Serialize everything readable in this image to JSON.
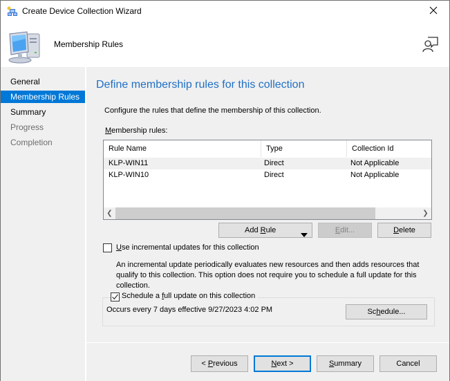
{
  "window": {
    "title": "Create Device Collection Wizard",
    "icons": {
      "app": "wizard-app-icon",
      "close": "close-icon"
    }
  },
  "banner": {
    "title": "Membership Rules",
    "icons": {
      "computer": "computer-icon",
      "help": "help-person-icon"
    }
  },
  "nav": {
    "items": [
      {
        "label": "General",
        "state": "normal"
      },
      {
        "label": "Membership Rules",
        "state": "selected"
      },
      {
        "label": "Summary",
        "state": "normal"
      },
      {
        "label": "Progress",
        "state": "disabled"
      },
      {
        "label": "Completion",
        "state": "disabled"
      }
    ]
  },
  "content": {
    "heading": "Define membership rules for this collection",
    "description": "Configure the rules that define the membership of this collection.",
    "rules_label": "Membership rules:",
    "rules_label_accel": "M",
    "rules_label_rest": "embership rules:",
    "table": {
      "columns": [
        "Rule Name",
        "Type",
        "Collection Id"
      ],
      "rows": [
        [
          "KLP-WIN11",
          "Direct",
          "Not Applicable"
        ],
        [
          "KLP-WIN10",
          "Direct",
          "Not Applicable"
        ]
      ]
    },
    "buttons": {
      "add_rule_pre": "Add ",
      "add_rule_accel": "R",
      "add_rule_post": "ule",
      "edit_accel": "E",
      "edit_post": "dit...",
      "delete_accel": "D",
      "delete_post": "elete",
      "schedule_pre": "Sc",
      "schedule_accel": "h",
      "schedule_post": "edule..."
    },
    "incremental": {
      "checked": false,
      "label_accel": "U",
      "label_rest": "se incremental updates for this collection",
      "description": "An incremental update periodically evaluates new resources and then adds resources that qualify to this collection. This option does not require you to schedule a full update for this collection."
    },
    "full_update": {
      "checked": true,
      "label_pre": "Schedule a ",
      "label_accel": "f",
      "label_post": "ull update on this collection",
      "schedule_text": "Occurs every 7 days effective 9/27/2023 4:02 PM"
    }
  },
  "footer": {
    "previous_pre": "< ",
    "previous_accel": "P",
    "previous_post": "revious",
    "next_accel": "N",
    "next_post": "ext >",
    "summary_accel": "S",
    "summary_post": "ummary",
    "cancel": "Cancel"
  },
  "colors": {
    "accent": "#0078d7",
    "heading": "#1f6fc5",
    "panel_bg": "#f0f0f0"
  }
}
